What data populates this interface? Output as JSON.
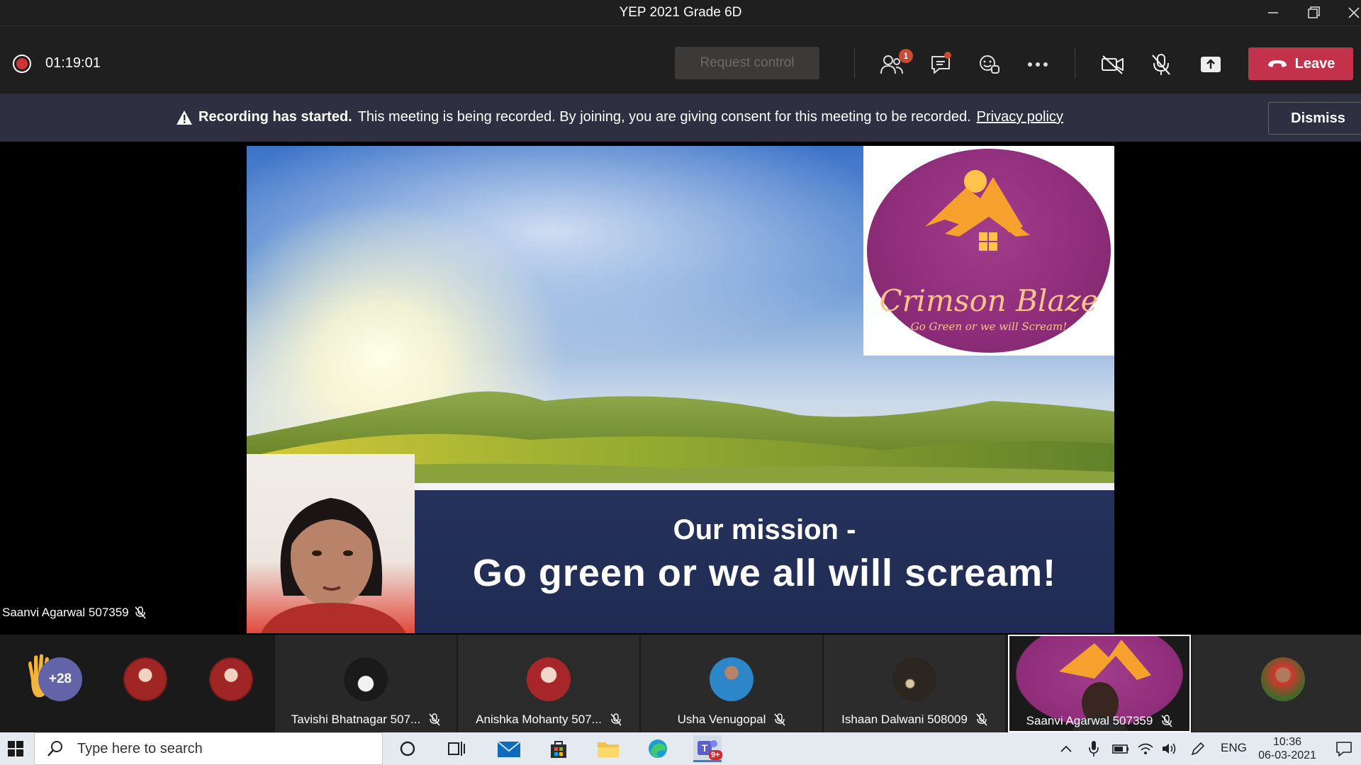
{
  "window": {
    "title": "YEP 2021 Grade 6D"
  },
  "toolbar": {
    "timer": "01:19:01",
    "request_control": "Request control",
    "people_badge": "1",
    "leave": "Leave"
  },
  "banner": {
    "bold": "Recording has started.",
    "text": "This meeting is being recorded. By joining, you are giving consent for this meeting to be recorded.",
    "link": "Privacy policy",
    "dismiss": "Dismiss"
  },
  "slide": {
    "logo_title": "Crimson Blaze",
    "logo_tagline": "Go Green or we will Scream!",
    "mission_line1": "Our mission -",
    "mission_line2": "Go green or we all will scream!"
  },
  "presenter": {
    "name": "Saanvi Agarwal 507359"
  },
  "participants": {
    "overflow": "+28",
    "tiles": [
      {
        "name": "Tavishi Bhatnagar 507..."
      },
      {
        "name": "Anishka Mohanty 507..."
      },
      {
        "name": "Usha Venugopal"
      },
      {
        "name": "Ishaan Dalwani 508009"
      },
      {
        "name": "Saanvi Agarwal 507359"
      }
    ]
  },
  "taskbar": {
    "search_placeholder": "Type here to search",
    "teams_badge": "9+",
    "language": "ENG",
    "time": "10:36",
    "date": "06-03-2021"
  },
  "colors": {
    "leave": "#c4314b",
    "banner": "#2e3042",
    "accent": "#6264a7",
    "badge": "#cc4a31"
  }
}
